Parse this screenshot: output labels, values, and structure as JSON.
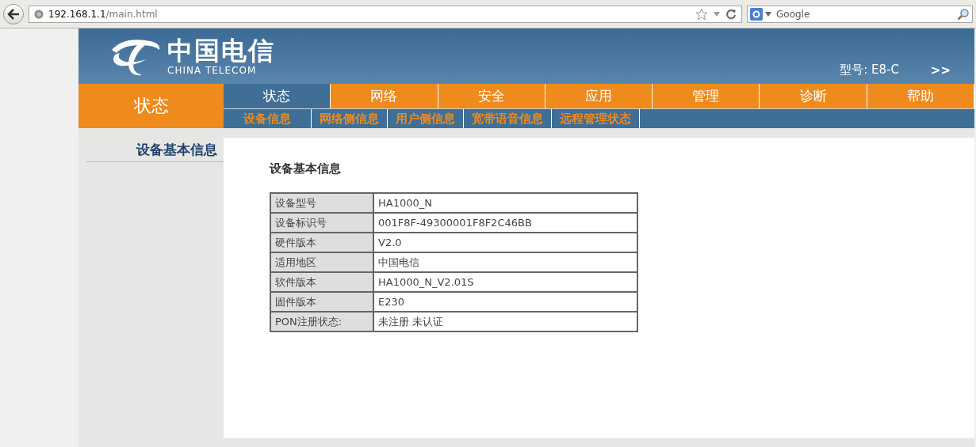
{
  "browser": {
    "url_host": "192.168.1.1",
    "url_path": "/main.html",
    "search_placeholder": "Google"
  },
  "header": {
    "logo_cn": "中国电信",
    "logo_en": "CHINA TELECOM",
    "model_label": "型号: E8-C",
    "more": ">>"
  },
  "section_title": "状态",
  "tabs": [
    {
      "label": "状态",
      "selected": true
    },
    {
      "label": "网络",
      "selected": false
    },
    {
      "label": "安全",
      "selected": false
    },
    {
      "label": "应用",
      "selected": false
    },
    {
      "label": "管理",
      "selected": false
    },
    {
      "label": "诊断",
      "selected": false
    },
    {
      "label": "帮助",
      "selected": false
    }
  ],
  "subtabs": [
    {
      "label": "设备信息"
    },
    {
      "label": "网络侧信息"
    },
    {
      "label": "用户侧信息"
    },
    {
      "label": "宽带语音信息"
    },
    {
      "label": "远程管理状态"
    }
  ],
  "sidebar": {
    "items": [
      {
        "label": "设备基本信息"
      }
    ]
  },
  "content": {
    "title": "设备基本信息",
    "rows": [
      {
        "label": "设备型号",
        "value": "HA1000_N"
      },
      {
        "label": "设备标识号",
        "value": "001F8F-49300001F8F2C46BB"
      },
      {
        "label": "硬件版本",
        "value": "V2.0"
      },
      {
        "label": "适用地区",
        "value": "中国电信"
      },
      {
        "label": "软件版本",
        "value": "HA1000_N_V2.01S"
      },
      {
        "label": "固件版本",
        "value": "E230"
      },
      {
        "label": "PON注册状态:",
        "value": "未注册 未认证"
      }
    ]
  }
}
